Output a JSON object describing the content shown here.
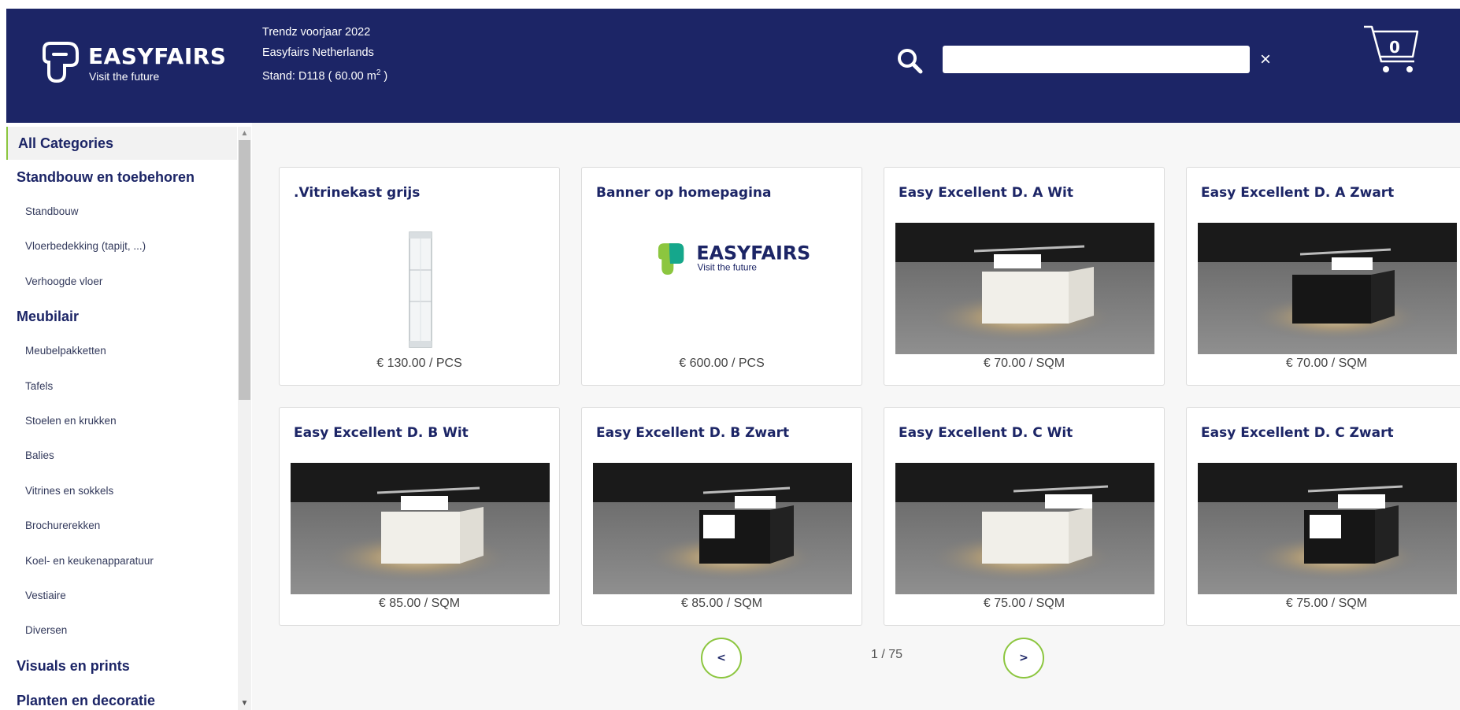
{
  "brand": {
    "name": "EASYFAIRS",
    "tagline": "Visit the future",
    "colors": {
      "navy": "#1c2566",
      "green": "#8cc63f",
      "teal": "#00a19a"
    }
  },
  "event": {
    "name": "Trendz voorjaar 2022",
    "organizer": "Easyfairs Netherlands",
    "stand_prefix": "Stand: D118 ( 60.00 m",
    "stand_sup": "2",
    "stand_suffix": " )"
  },
  "search": {
    "value": "",
    "placeholder": "",
    "icon": "search-icon",
    "clear_label": "×"
  },
  "cart": {
    "count": "0",
    "icon": "cart-icon"
  },
  "sidebar": {
    "all": "All Categories",
    "groups": [
      {
        "label": "Standbouw en toebehoren",
        "items": [
          "Standbouw",
          "Vloerbedekking (tapijt, ...)",
          "Verhoogde vloer"
        ]
      },
      {
        "label": "Meubilair",
        "items": [
          "Meubelpakketten",
          "Tafels",
          "Stoelen en krukken",
          "Balies",
          "Vitrines en sokkels",
          "Brochurerekken",
          "Koel- en keukenapparatuur",
          "Vestiaire",
          "Diversen"
        ]
      },
      {
        "label": "Visuals en prints",
        "items": []
      },
      {
        "label": "Planten en decoratie",
        "items": []
      }
    ],
    "scroll_up": "▲",
    "scroll_down": "▼"
  },
  "products": [
    {
      "title": ".Vitrinekast grijs",
      "price": "€ 130.00 / PCS",
      "image": "display-cabinet"
    },
    {
      "title": "Banner op homepagina",
      "price": "€ 600.00 / PCS",
      "image": "easyfairs-logo"
    },
    {
      "title": "Easy Excellent D. A Wit",
      "price": "€ 70.00 / SQM",
      "image": "stand-white"
    },
    {
      "title": "Easy Excellent D. A Zwart",
      "price": "€ 70.00 / SQM",
      "image": "stand-black"
    },
    {
      "title": "Easy Excellent D. B Wit",
      "price": "€ 85.00 / SQM",
      "image": "stand-white"
    },
    {
      "title": "Easy Excellent D. B Zwart",
      "price": "€ 85.00 / SQM",
      "image": "stand-black"
    },
    {
      "title": "Easy Excellent D. C Wit",
      "price": "€ 75.00 / SQM",
      "image": "stand-white"
    },
    {
      "title": "Easy Excellent D. C Zwart",
      "price": "€ 75.00 / SQM",
      "image": "stand-black"
    }
  ],
  "pagination": {
    "prev": "<",
    "next": ">",
    "status": "1 / 75"
  }
}
